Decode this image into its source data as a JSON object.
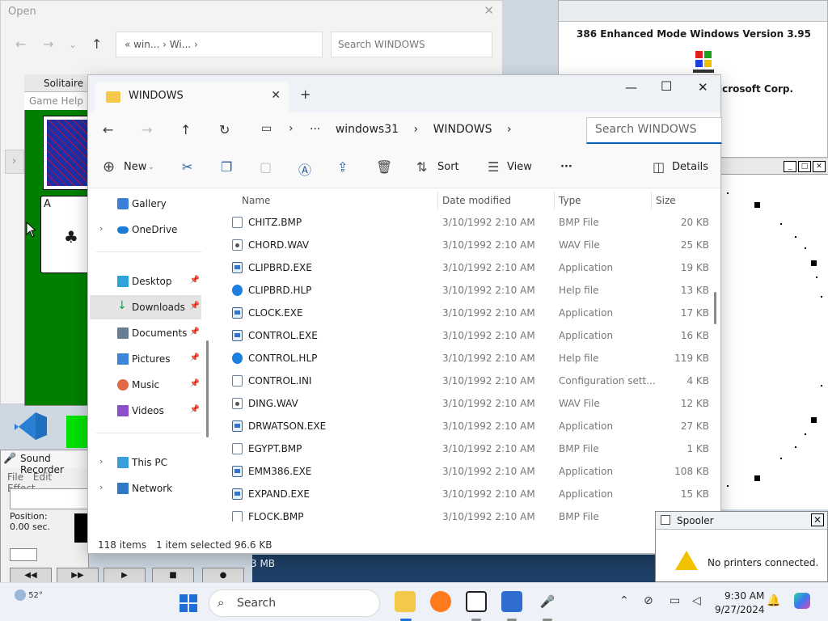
{
  "open_dialog": {
    "title": "Open",
    "address": "«  win...  ›  Wi...  ›",
    "search_placeholder": "Search WINDOWS"
  },
  "about_dialog": {
    "line1": "386 Enhanced Mode Windows Version 3.95",
    "line2": "icrosoft Corp."
  },
  "solitaire": {
    "title": "Solitaire",
    "menu": "Game   Help",
    "ace_rank": "A",
    "ace_suit": "♣"
  },
  "sound_recorder": {
    "title": "Sound Recorder",
    "menu": "File  Edit  Effect",
    "position_label": "Position:",
    "position_value": "0.00 sec."
  },
  "explorer": {
    "tab_title": "WINDOWS",
    "breadcrumb": [
      "···",
      "windows31",
      "›",
      "WINDOWS",
      "›"
    ],
    "search_placeholder": "Search WINDOWS",
    "toolbar": {
      "new": "New",
      "sort": "Sort",
      "view": "View",
      "more": "···",
      "details": "Details"
    },
    "nav": [
      {
        "label": "Gallery"
      },
      {
        "label": "OneDrive"
      },
      {
        "label": "Desktop"
      },
      {
        "label": "Downloads"
      },
      {
        "label": "Documents"
      },
      {
        "label": "Pictures"
      },
      {
        "label": "Music"
      },
      {
        "label": "Videos"
      },
      {
        "label": "This PC"
      },
      {
        "label": "Network"
      }
    ],
    "columns": {
      "name": "Name",
      "date": "Date modified",
      "type": "Type",
      "size": "Size"
    },
    "files": [
      {
        "name": "CHITZ.BMP",
        "date": "3/10/1992 2:10 AM",
        "type": "BMP File",
        "size": "20 KB",
        "kind": "bmp"
      },
      {
        "name": "CHORD.WAV",
        "date": "3/10/1992 2:10 AM",
        "type": "WAV File",
        "size": "25 KB",
        "kind": "wav"
      },
      {
        "name": "CLIPBRD.EXE",
        "date": "3/10/1992 2:10 AM",
        "type": "Application",
        "size": "19 KB",
        "kind": "exe"
      },
      {
        "name": "CLIPBRD.HLP",
        "date": "3/10/1992 2:10 AM",
        "type": "Help file",
        "size": "13 KB",
        "kind": "hlp"
      },
      {
        "name": "CLOCK.EXE",
        "date": "3/10/1992 2:10 AM",
        "type": "Application",
        "size": "17 KB",
        "kind": "exe"
      },
      {
        "name": "CONTROL.EXE",
        "date": "3/10/1992 2:10 AM",
        "type": "Application",
        "size": "16 KB",
        "kind": "exe"
      },
      {
        "name": "CONTROL.HLP",
        "date": "3/10/1992 2:10 AM",
        "type": "Help file",
        "size": "119 KB",
        "kind": "hlp"
      },
      {
        "name": "CONTROL.INI",
        "date": "3/10/1992 2:10 AM",
        "type": "Configuration sett...",
        "size": "4 KB",
        "kind": "ini"
      },
      {
        "name": "DING.WAV",
        "date": "3/10/1992 2:10 AM",
        "type": "WAV File",
        "size": "12 KB",
        "kind": "wav"
      },
      {
        "name": "DRWATSON.EXE",
        "date": "3/10/1992 2:10 AM",
        "type": "Application",
        "size": "27 KB",
        "kind": "exe"
      },
      {
        "name": "EGYPT.BMP",
        "date": "3/10/1992 2:10 AM",
        "type": "BMP File",
        "size": "1 KB",
        "kind": "bmp"
      },
      {
        "name": "EMM386.EXE",
        "date": "3/10/1992 2:10 AM",
        "type": "Application",
        "size": "108 KB",
        "kind": "exe"
      },
      {
        "name": "EXPAND.EXE",
        "date": "3/10/1992 2:10 AM",
        "type": "Application",
        "size": "15 KB",
        "kind": "exe"
      },
      {
        "name": "FLOCK.BMP",
        "date": "3/10/1992 2:10 AM",
        "type": "BMP File",
        "size": "",
        "kind": "bmp"
      }
    ],
    "status": {
      "count": "118 items",
      "selected": "1 item selected  96.6 KB"
    }
  },
  "spooler": {
    "title": "Spooler",
    "message": "No printers connected."
  },
  "mb_text": "3 MB",
  "taskbar": {
    "weather": "52°",
    "search": "Search",
    "time": "9:30 AM",
    "date": "9/27/2024"
  }
}
